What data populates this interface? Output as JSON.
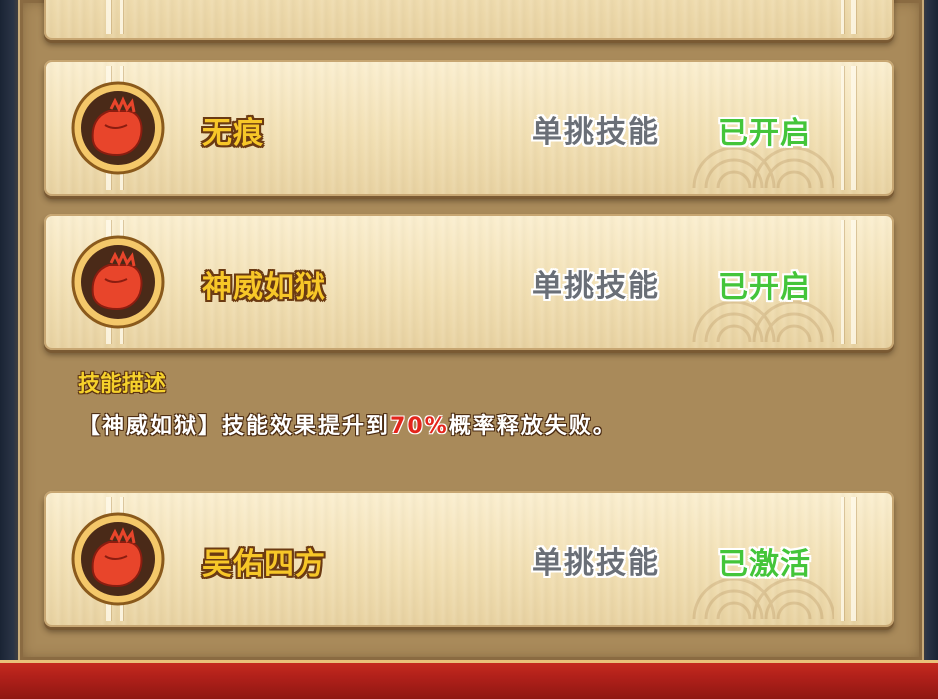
{
  "skills": [
    {
      "name": "无痕",
      "type": "单挑技能",
      "status": "已开启"
    },
    {
      "name": "神威如狱",
      "type": "单挑技能",
      "status": "已开启"
    },
    {
      "name": "吴佑四方",
      "type": "单挑技能",
      "status": "已激活"
    }
  ],
  "description": {
    "title": "技能描述",
    "text_before": "【神威如狱】技能效果提升到",
    "highlight": "70%",
    "text_after": "概率释放失败。"
  },
  "colors": {
    "status_green": "#44c53a",
    "highlight_red": "#e3251b",
    "name_gold": "#f7c728",
    "panel_brown": "#a98a5a"
  },
  "icons": {
    "skill_icon": "red-fist-icon"
  }
}
